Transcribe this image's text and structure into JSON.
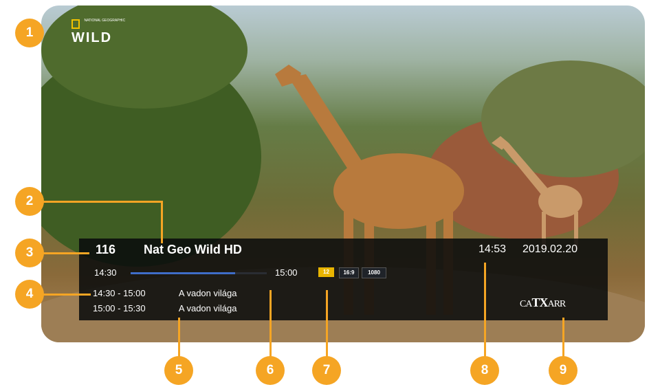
{
  "channel_logo": {
    "brand_small": "NATIONAL GEOGRAPHIC",
    "name": "WILD"
  },
  "osd": {
    "channel_number": "116",
    "channel_name": "Nat Geo Wild HD",
    "clock": "14:53",
    "date": "2019.02.20",
    "program_start": "14:30",
    "program_end": "15:00",
    "progress": 0.77,
    "badges": {
      "age_rating": "12",
      "aspect": "16:9",
      "resolution": "1080"
    },
    "epg": [
      {
        "time": "14:30 - 15:00",
        "title": "A vadon világa"
      },
      {
        "time": "15:00 - 15:30",
        "title": "A vadon világa"
      }
    ],
    "provider_logo": {
      "prefix": "CA",
      "main": "TX",
      "suffix": "ARR"
    }
  },
  "callouts": [
    "1",
    "2",
    "3",
    "4",
    "5",
    "6",
    "7",
    "8",
    "9"
  ],
  "colors": {
    "accent": "#f5a524",
    "osd_background": "#08090c",
    "progress": "#3f6dc8",
    "age_badge": "#e8b400"
  }
}
